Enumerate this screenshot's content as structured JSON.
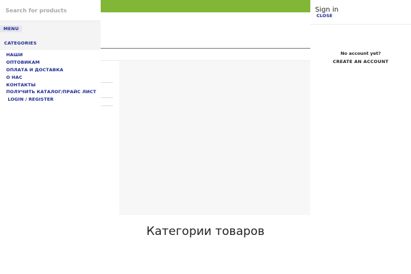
{
  "search": {
    "placeholder": "Search for products"
  },
  "side_menu": {
    "tabs": {
      "menu": "MENU",
      "categories": "CATEGORIES"
    },
    "items": [
      {
        "label": "НАШИ"
      },
      {
        "label": "ОПТОВИКАМ"
      },
      {
        "label": "ОПЛАТА И ДОСТАВКА"
      },
      {
        "label": "О НАС"
      },
      {
        "label": "КОНТАКТЫ"
      },
      {
        "label": "ПОЛУЧИТЬ КАТАЛОГ/ПРАЙС ЛИСТ"
      },
      {
        "label": " LOGIN / REGISTER"
      }
    ]
  },
  "signin_panel": {
    "title": "Sign in",
    "close": "CLOSE",
    "no_account": "No account yet?",
    "create_account": "CREATE AN ACCOUNT"
  },
  "main": {
    "category_heading": "Категории товаров"
  },
  "colors": {
    "topbar": "#82b636",
    "link": "#1f2a8f"
  }
}
